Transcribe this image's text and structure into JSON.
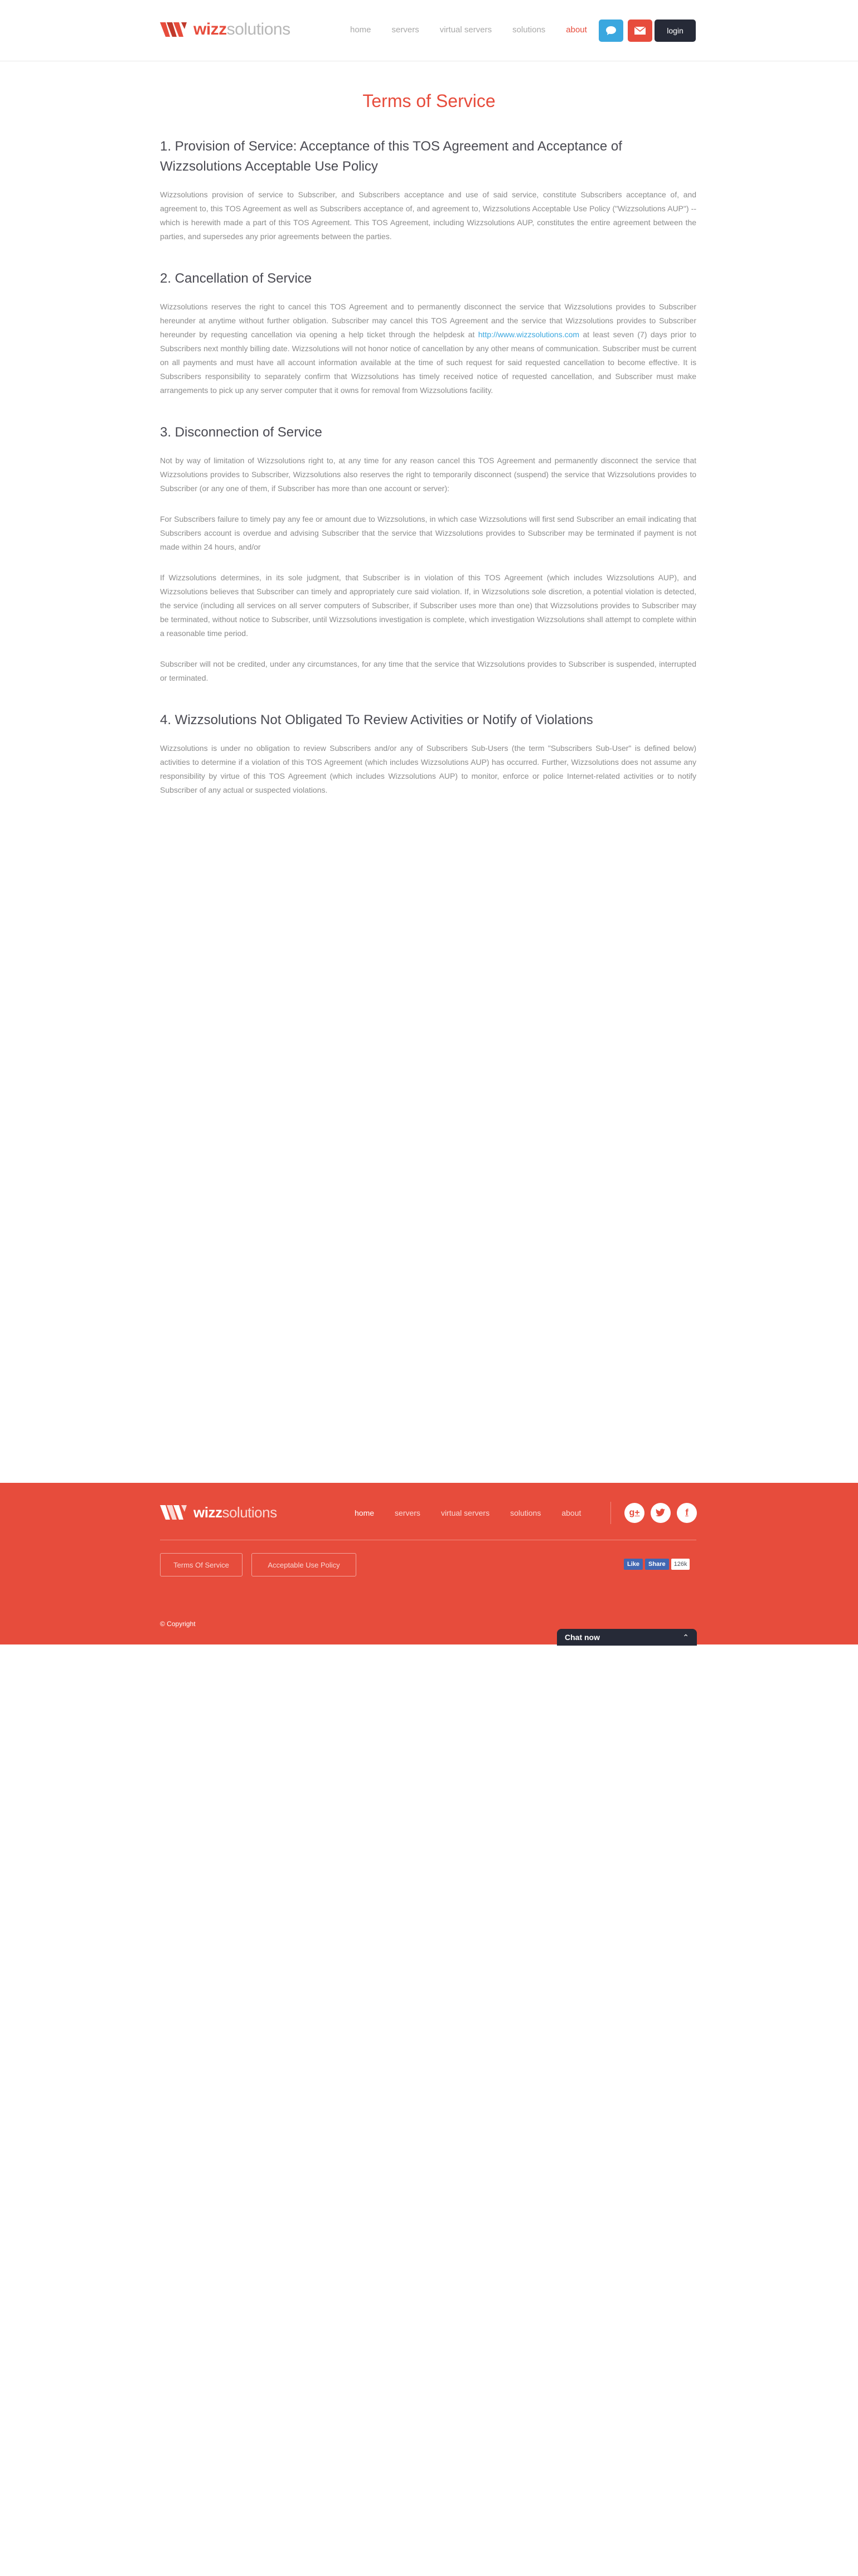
{
  "brand": {
    "name_strong": "wizz",
    "name_rest": "solutions",
    "accent": "#e74c3c",
    "dark": "#262a37",
    "blue": "#3aa7df"
  },
  "header": {
    "nav": [
      "home",
      "servers",
      "virtual servers",
      "solutions",
      "about"
    ],
    "active_nav": "about",
    "chat_icon": "speech-bubble-icon",
    "mail_icon": "envelope-icon",
    "login_label": "login"
  },
  "page": {
    "title": "Terms of Service",
    "sections": [
      {
        "heading": "1. Provision of Service: Acceptance of this TOS Agreement and Acceptance of Wizzsolutions Acceptable Use Policy",
        "paragraphs": [
          "Wizzsolutions provision of service to Subscriber, and Subscribers acceptance and use of said service, constitute Subscribers acceptance of, and agreement to, this TOS Agreement as well as Subscribers acceptance of, and agreement to, Wizzsolutions Acceptable Use Policy (\"Wizzsolutions AUP\") -- which is herewith made a part of this TOS Agreement. This TOS Agreement, including Wizzsolutions AUP, constitutes the entire agreement between the parties, and supersedes any prior agreements between the parties."
        ]
      },
      {
        "heading": "2. Cancellation of Service",
        "p1_before_link": "Wizzsolutions reserves the right to cancel this TOS Agreement and to permanently disconnect the service that Wizzsolutions provides to Subscriber hereunder at anytime without further obligation. Subscriber may cancel this TOS Agreement and the service that Wizzsolutions provides to Subscriber hereunder by requesting cancellation via opening a help ticket through the helpdesk at ",
        "link": "http://www.wizzsolutions.com",
        "p1_after_link": " at least seven (7) days prior to Subscribers next monthly billing date. Wizzsolutions will not honor notice of cancellation by any other means of communication. Subscriber must be current on all payments and must have all account information available at the time of such request for said requested cancellation to become effective. It is Subscribers responsibility to separately confirm that Wizzsolutions has timely received notice of requested cancellation, and Subscriber must make arrangements to pick up any server computer that it owns for removal from Wizzsolutions facility."
      },
      {
        "heading": "3. Disconnection of Service",
        "paragraphs": [
          "Not by way of limitation of Wizzsolutions right to, at any time for any reason cancel this TOS Agreement and permanently disconnect the service that Wizzsolutions provides to Subscriber, Wizzsolutions also reserves the right to temporarily disconnect (suspend) the service that Wizzsolutions provides to Subscriber (or any one of them, if Subscriber has more than one account or server):",
          "For Subscribers failure to timely pay any fee or amount due to Wizzsolutions, in which case Wizzsolutions will first send Subscriber an email indicating that Subscribers account is overdue and advising Subscriber that the service that Wizzsolutions provides to Subscriber may be terminated if payment is not made within 24 hours, and/or",
          "If Wizzsolutions determines, in its sole judgment, that Subscriber is in violation of this TOS Agreement (which includes Wizzsolutions AUP), and Wizzsolutions believes that Subscriber can timely and appropriately cure said violation. If, in Wizzsolutions sole discretion, a potential violation is detected, the service (including all services on all server computers of Subscriber, if Subscriber uses more than one) that Wizzsolutions provides to Subscriber may be terminated, without notice to Subscriber, until Wizzsolutions investigation is complete, which investigation Wizzsolutions shall attempt to complete within a reasonable time period.",
          "Subscriber will not be credited, under any circumstances, for any time that the service that Wizzsolutions provides to Subscriber is suspended, interrupted or terminated."
        ]
      },
      {
        "heading": "4. Wizzsolutions Not Obligated To Review Activities or Notify of Violations",
        "paragraphs": [
          "Wizzsolutions is under no obligation to review Subscribers and/or any of Subscribers Sub-Users (the term \"Subscribers Sub-User\" is defined below) activities to determine if a violation of this TOS Agreement (which includes Wizzsolutions AUP) has occurred. Further, Wizzsolutions does not assume any responsibility by virtue of this TOS Agreement (which includes Wizzsolutions AUP) to monitor, enforce or police Internet-related activities or to notify Subscriber of any actual or suspected violations."
        ]
      }
    ]
  },
  "footer": {
    "nav": [
      "home",
      "servers",
      "virtual servers",
      "solutions",
      "about"
    ],
    "active_nav": "home",
    "social_icons": [
      "google-plus-icon",
      "twitter-icon",
      "facebook-icon"
    ],
    "links": [
      "Terms Of Service",
      "Acceptable Use Policy"
    ],
    "fb_like": "Like",
    "fb_share": "Share",
    "fb_count": "126k",
    "copyright": "© Copyright"
  },
  "chat": {
    "label": "Chat now"
  }
}
